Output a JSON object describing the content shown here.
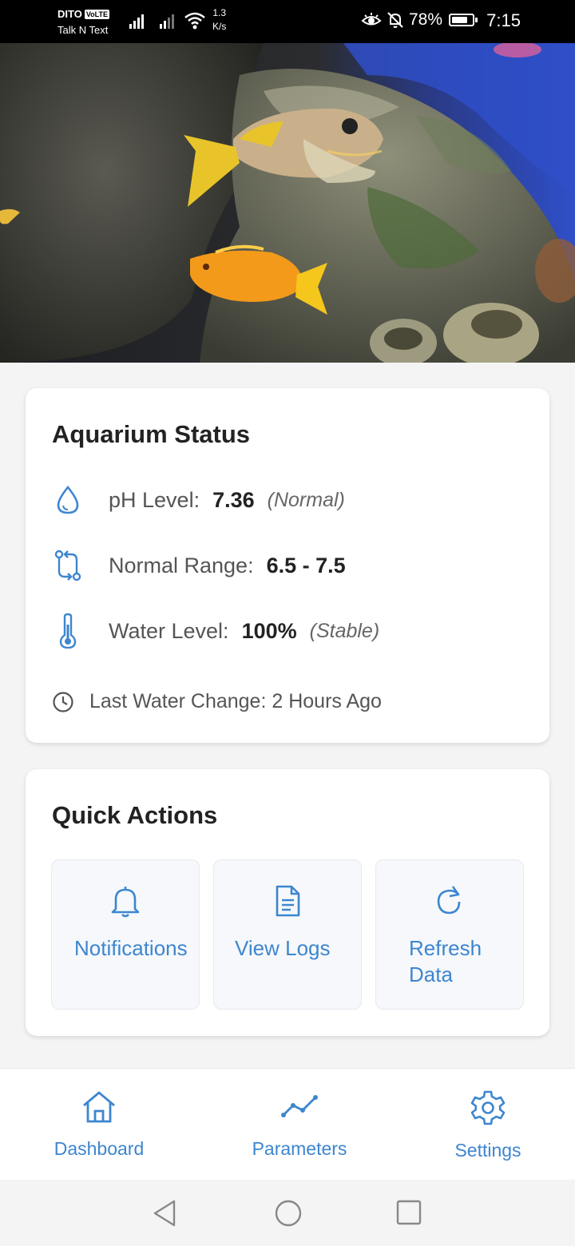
{
  "status_bar": {
    "carrier": "DITO",
    "volte": "VoLTE",
    "carrier_sub": "Talk N Text",
    "net_speed_value": "1.3",
    "net_speed_unit": "K/s",
    "battery": "78%",
    "battery_fraction": 0.78,
    "time": "7:15"
  },
  "status_card": {
    "title": "Aquarium Status",
    "ph": {
      "label": "pH Level:",
      "value": "7.36",
      "note": "(Normal)"
    },
    "range": {
      "label": "Normal Range:",
      "value": "6.5 - 7.5"
    },
    "water": {
      "label": "Water Level:",
      "value": "100%",
      "note": "(Stable)"
    },
    "last_change": "Last Water Change: 2 Hours Ago"
  },
  "actions_card": {
    "title": "Quick Actions",
    "notifications": "Notifications",
    "view_logs": "View Logs",
    "refresh": "Refresh Data"
  },
  "bottom_nav": {
    "dashboard": "Dashboard",
    "parameters": "Parameters",
    "settings": "Settings"
  },
  "colors": {
    "accent": "#3d86cf",
    "card": "#ffffff",
    "background": "#f4f4f5"
  }
}
